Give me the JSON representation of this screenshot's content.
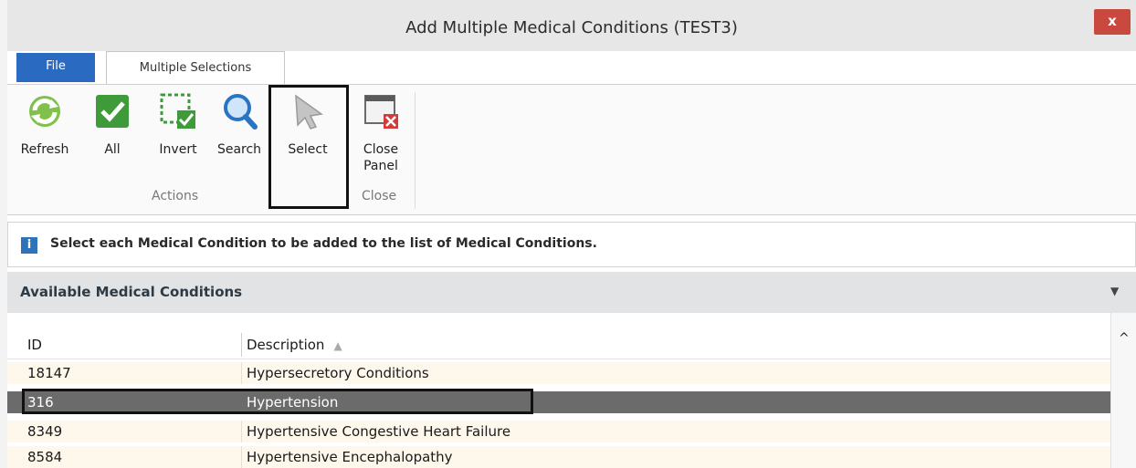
{
  "window": {
    "title": "Add Multiple Medical Conditions (TEST3)",
    "close_label": "x"
  },
  "tabs": {
    "file": "File",
    "multiple_selections": "Multiple Selections"
  },
  "ribbon": {
    "refresh": "Refresh",
    "all": "All",
    "invert": "Invert",
    "search": "Search",
    "select": "Select",
    "close_panel_line1": "Close",
    "close_panel_line2": "Panel",
    "group_actions": "Actions",
    "group_close": "Close"
  },
  "info": {
    "icon": "i",
    "text": "Select each Medical Condition to be added to the list of Medical Conditions."
  },
  "section": {
    "title": "Available Medical Conditions",
    "caret": "▼"
  },
  "grid": {
    "headers": {
      "id": "ID",
      "description": "Description",
      "sort": "▲"
    },
    "rows": [
      {
        "id": "18147",
        "description": "Hypersecretory Conditions"
      },
      {
        "id": "316",
        "description": "Hypertension"
      },
      {
        "id": "8349",
        "description": "Hypertensive Congestive Heart Failure"
      },
      {
        "id": "8584",
        "description": "Hypertensive Encephalopathy"
      }
    ],
    "selected_row": 1
  },
  "scroll": {
    "up": "^"
  },
  "colors": {
    "file_tab": "#2a6ac0",
    "selected_row": "#6b6b6b",
    "row_bg": "#fdf8eb",
    "close_button": "#c9493f"
  }
}
